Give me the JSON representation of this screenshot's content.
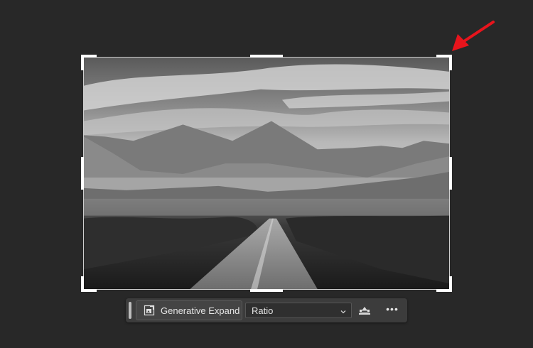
{
  "canvas": {
    "background": "#282828",
    "image_description_icon": "landscape-photo",
    "annotation_color": "#e8141c"
  },
  "taskbar": {
    "generative_expand_label": "Generative Expand",
    "generative_expand_icon": "generative-expand-icon",
    "ratio_selected": "Ratio",
    "straighten_icon": "straighten-icon",
    "more_label": "•••"
  }
}
